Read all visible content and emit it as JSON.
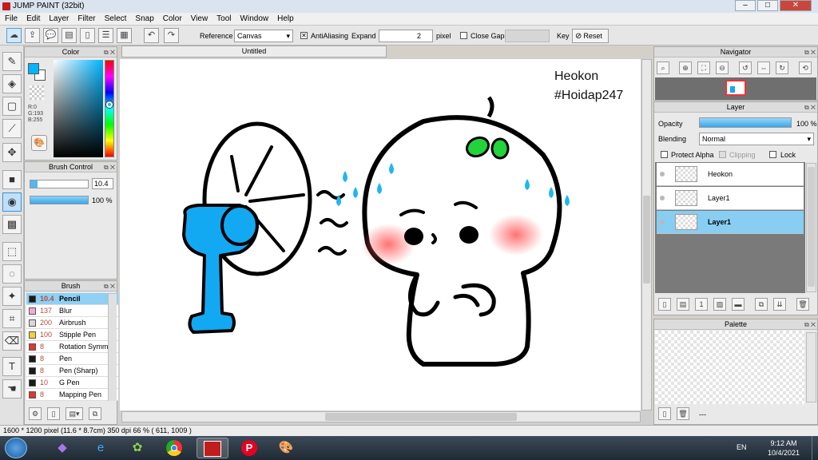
{
  "window": {
    "title": "JUMP PAINT (32bit)",
    "min": "–",
    "max": "□",
    "close": "✕"
  },
  "menu": [
    "File",
    "Edit",
    "Layer",
    "Filter",
    "Select",
    "Snap",
    "Color",
    "View",
    "Tool",
    "Window",
    "Help"
  ],
  "toolbar": {
    "reference_label": "Reference",
    "reference_value": "Canvas",
    "antialiasing_label": "AntiAliasing",
    "expand_label": "Expand",
    "expand_value": "2",
    "pixel_label": "pixel",
    "close_gaps_label": "Close Gaps",
    "key_label": "Key",
    "reset_label": "Reset"
  },
  "color_panel": {
    "title": "Color",
    "rgb": [
      "R:0",
      "G:193",
      "B:255"
    ],
    "foreground": "#00b4ff",
    "background": "#ffffff"
  },
  "brush_control": {
    "title": "Brush Control",
    "size_value": "10.4",
    "opacity_value": "100 %",
    "opacity_level": 1.0
  },
  "brush_panel": {
    "title": "Brush",
    "items": [
      {
        "size": "10.4",
        "name": "Pencil",
        "color": "#1a1a1a"
      },
      {
        "size": "137",
        "name": "Blur",
        "color": "#f6a9d6"
      },
      {
        "size": "200",
        "name": "Airbrush",
        "color": "#d8d8d8"
      },
      {
        "size": "100",
        "name": "Stipple Pen",
        "color": "#f3d03a"
      },
      {
        "size": "8",
        "name": "Rotation Symm",
        "color": "#e43434"
      },
      {
        "size": "8",
        "name": "Pen",
        "color": "#1a1a1a"
      },
      {
        "size": "8",
        "name": "Pen (Sharp)",
        "color": "#1a1a1a"
      },
      {
        "size": "10",
        "name": "G Pen",
        "color": "#1a1a1a"
      },
      {
        "size": "8",
        "name": "Mapping Pen",
        "color": "#e43434"
      }
    ]
  },
  "canvas": {
    "tab_title": "Untitled",
    "watermark_line1": "Heokon",
    "watermark_line2": "#Hoidap247"
  },
  "navigator": {
    "title": "Navigator"
  },
  "layer_panel": {
    "title": "Layer",
    "opacity_label": "Opacity",
    "opacity_value": "100 %",
    "blending_label": "Blending",
    "blending_value": "Normal",
    "protect_alpha_label": "Protect Alpha",
    "clipping_label": "Clipping",
    "lock_label": "Lock",
    "layers": [
      {
        "name": "Heokon",
        "selected": false
      },
      {
        "name": "Layer1",
        "selected": false
      },
      {
        "name": "Layer1",
        "selected": true
      }
    ]
  },
  "palette": {
    "title": "Palette",
    "more_label": "---"
  },
  "status": {
    "info": "1600 * 1200 pixel   (11.6 * 8.7cm)   350 dpi   66 %   ( 611, 1009 )"
  },
  "taskbar": {
    "lang": "EN",
    "time": "9:12 AM",
    "date": "10/4/2021"
  },
  "colors": {
    "accent": "#3d8fd1",
    "fan_blue": "#13a8f2",
    "selection": "#88cdf2"
  }
}
